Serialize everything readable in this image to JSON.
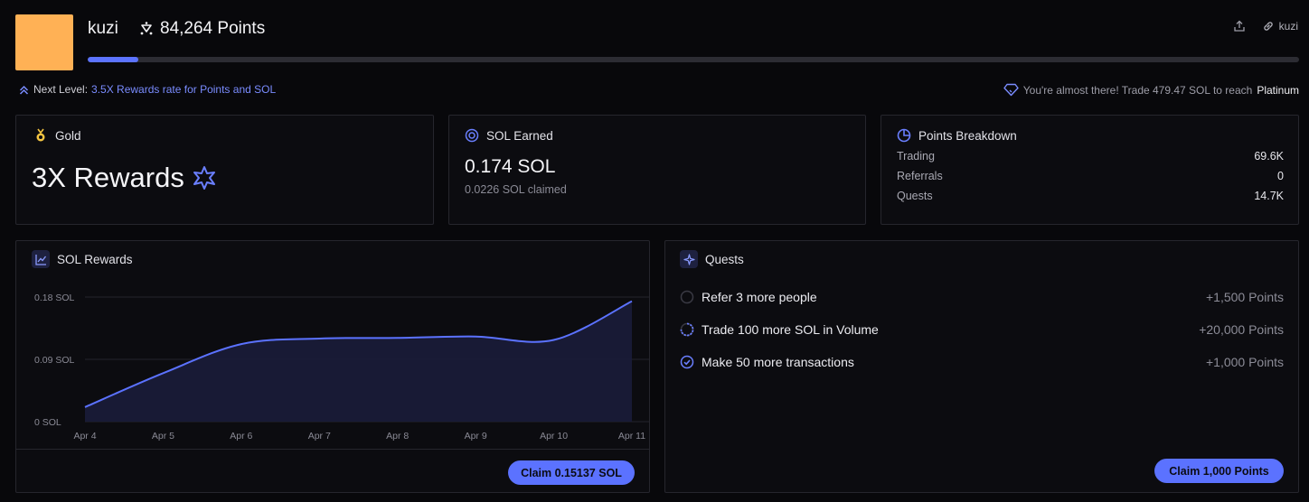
{
  "profile": {
    "username": "kuzi",
    "points": "84,264 Points",
    "avatar_color": "#ffb155",
    "progress_pct": 4.2
  },
  "actions": {
    "share_icon": "share-icon",
    "link_label": "kuzi"
  },
  "next_level": {
    "prefix": "Next Level:",
    "text": "3.5X Rewards rate for Points and SOL"
  },
  "almost": {
    "text": "You're almost there! Trade 479.47 SOL to reach",
    "tier": "Platinum"
  },
  "gold_card": {
    "title": "Gold",
    "rewards": "3X Rewards"
  },
  "sol_card": {
    "title": "SOL Earned",
    "amount": "0.174 SOL",
    "claimed": "0.0226 SOL claimed"
  },
  "points_card": {
    "title": "Points Breakdown",
    "rows": [
      {
        "label": "Trading",
        "value": "69.6K"
      },
      {
        "label": "Referrals",
        "value": "0"
      },
      {
        "label": "Quests",
        "value": "14.7K"
      }
    ]
  },
  "chart_card": {
    "title": "SOL Rewards",
    "claim_label": "Claim 0.15137 SOL"
  },
  "chart_data": {
    "type": "area",
    "x": [
      "Apr 4",
      "Apr 5",
      "Apr 6",
      "Apr 7",
      "Apr 8",
      "Apr 9",
      "Apr 10",
      "Apr 11"
    ],
    "values": [
      0.021,
      0.07,
      0.112,
      0.12,
      0.121,
      0.123,
      0.118,
      0.174
    ],
    "ylim": [
      0,
      0.18
    ],
    "yticks": [
      {
        "v": 0,
        "label": "0 SOL"
      },
      {
        "v": 0.09,
        "label": "0.09 SOL"
      },
      {
        "v": 0.18,
        "label": "0.18 SOL"
      }
    ],
    "grid": true,
    "line_color": "#5b72ff",
    "fill_color": "#1a1c3a"
  },
  "quests_card": {
    "title": "Quests",
    "items": [
      {
        "label": "Refer 3 more people",
        "reward": "+1,500 Points",
        "status": "todo"
      },
      {
        "label": "Trade 100 more SOL in Volume",
        "reward": "+20,000 Points",
        "status": "in-progress"
      },
      {
        "label": "Make 50 more transactions",
        "reward": "+1,000 Points",
        "status": "done"
      }
    ],
    "claim_label": "Claim 1,000 Points"
  },
  "colors": {
    "accent": "#5b72ff",
    "gold": "#f5c542"
  }
}
